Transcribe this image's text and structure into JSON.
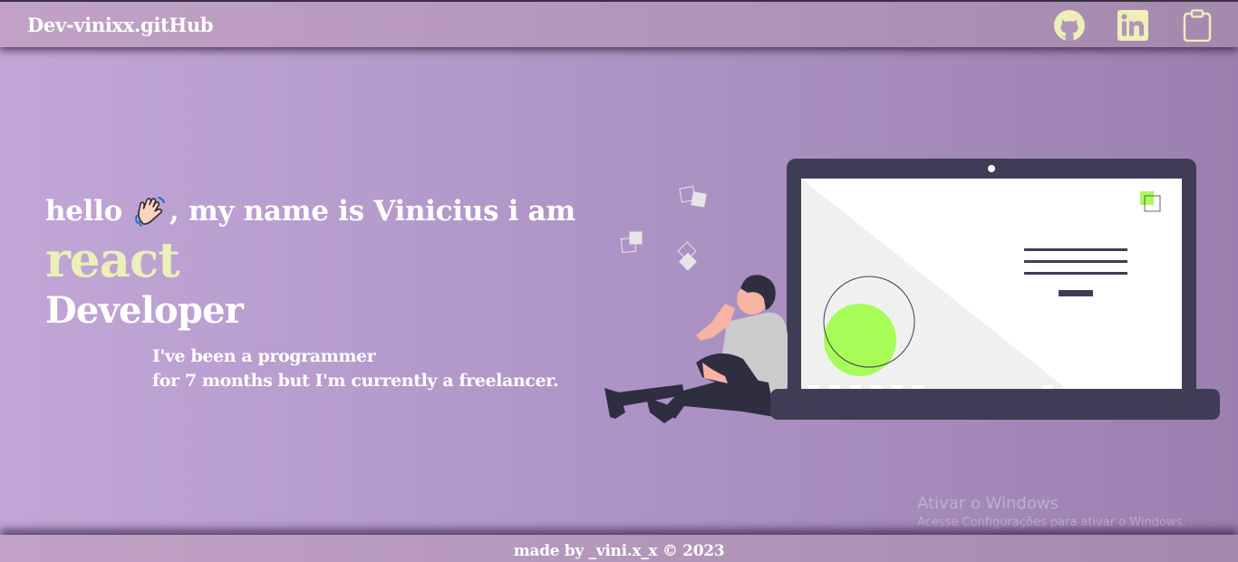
{
  "header": {
    "brand": "Dev-vinixx.gitHub",
    "links": [
      {
        "name": "github-icon",
        "color": "#ecefb7"
      },
      {
        "name": "linkedin-icon",
        "color": "#ecefb7"
      },
      {
        "name": "clipboard-icon",
        "color": "#ecefb7"
      }
    ]
  },
  "hero": {
    "greeting_start": "hello",
    "greeting_end": ", my name is Vinicius i am",
    "greeting_icon": "waving-hand-icon",
    "role": "react",
    "title": "Developer",
    "bio_line1": "I've been a programmer",
    "bio_line2": "for 7 months but I'm currently a freelancer."
  },
  "watermark": {
    "title": "Ativar o Windows",
    "subtitle": "Acesse Configurações para ativar o Windows."
  },
  "footer": {
    "text": "made by _vini.x_x © 2023"
  },
  "colors": {
    "accent": "#ecefb7",
    "background_start": "#c2a6d8",
    "background_end": "#9b7fb0",
    "laptop": "#3f3d56",
    "highlight": "#a8fc58"
  }
}
